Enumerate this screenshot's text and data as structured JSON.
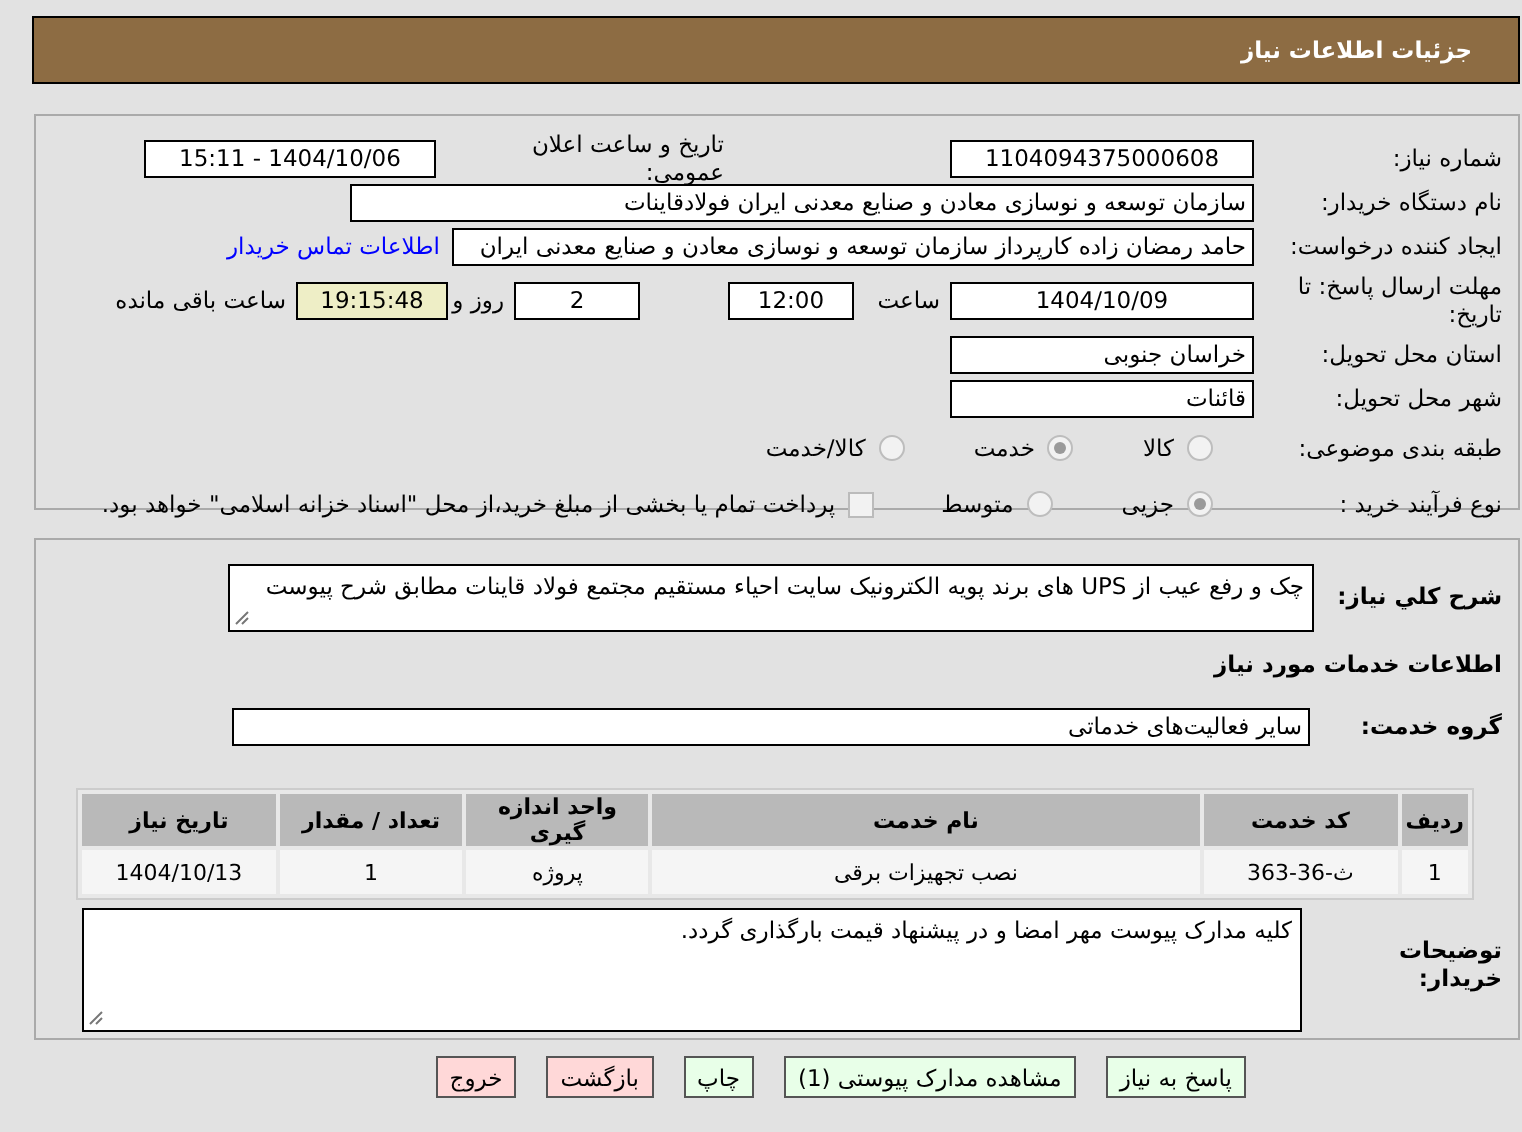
{
  "header": {
    "title": "جزئیات اطلاعات نیاز"
  },
  "details": {
    "need_number": {
      "label": "شماره نیاز:",
      "value": "1104094375000608"
    },
    "announce": {
      "label": "تاریخ و ساعت اعلان عمومی:",
      "value": "1404/10/06 - 15:11"
    },
    "buyer": {
      "label": "نام دستگاه خریدار:",
      "value": "سازمان توسعه و نوسازی معادن و صنایع معدنی ایران فولادقاینات"
    },
    "creator": {
      "label": "ایجاد کننده درخواست:",
      "value": "حامد  رمضان زاده  کارپرداز  سازمان توسعه و نوسازی معادن و صنایع معدنی ایران",
      "link": "اطلاعات تماس خریدار"
    },
    "deadline": {
      "label": "مهلت ارسال پاسخ: تا تاریخ:",
      "date": "1404/10/09",
      "time_label": "ساعت",
      "time": "12:00",
      "days": "2",
      "days_label": "روز و",
      "remaining": "19:15:48",
      "remaining_label": "ساعت باقی مانده"
    },
    "province": {
      "label": "استان محل تحویل:",
      "value": "خراسان جنوبی"
    },
    "city": {
      "label": "شهر محل تحویل:",
      "value": "قائنات"
    },
    "category": {
      "label": "طبقه بندی موضوعی:",
      "options": [
        {
          "label": "کالا",
          "selected": false
        },
        {
          "label": "خدمت",
          "selected": true
        },
        {
          "label": "کالا/خدمت",
          "selected": false
        }
      ]
    },
    "process": {
      "label": "نوع فرآیند خرید :",
      "options": [
        {
          "label": "جزیی",
          "selected": true
        },
        {
          "label": "متوسط",
          "selected": false
        }
      ],
      "payment": {
        "checked": false,
        "label": "پرداخت تمام یا بخشی از مبلغ خرید،از محل \"اسناد خزانه اسلامی\" خواهد بود."
      }
    }
  },
  "services": {
    "description": {
      "label": "شرح کلي نياز:",
      "value": "چک و رفع عیب از UPS های برند پویه الکترونیک سایت احیاء مستقیم مجتمع فولاد قاینات مطابق شرح پیوست"
    },
    "section_title": "اطلاعات خدمات مورد نیاز",
    "group": {
      "label": "گروه خدمت:",
      "value": "سایر فعالیت‌های خدماتی"
    },
    "table": {
      "columns": [
        "ردیف",
        "کد خدمت",
        "نام خدمت",
        "واحد اندازه گیری",
        "تعداد / مقدار",
        "تاریخ نیاز"
      ],
      "rows": [
        [
          "1",
          "ث-36-363",
          "نصب تجهیزات برقی",
          "پروژه",
          "1",
          "1404/10/13"
        ]
      ]
    },
    "notes": {
      "label": "توضیحات خریدار:",
      "value": "کلیه مدارک پیوست مهر امضا و در پیشنهاد قیمت بارگذاری گردد."
    }
  },
  "buttons": [
    {
      "label": "پاسخ به نیاز",
      "kind": "green"
    },
    {
      "label": "مشاهده مدارک پیوستی (1)",
      "kind": "green"
    },
    {
      "label": "چاپ",
      "kind": "green"
    },
    {
      "label": "بازگشت",
      "kind": "red"
    },
    {
      "label": "خروج",
      "kind": "red"
    }
  ]
}
